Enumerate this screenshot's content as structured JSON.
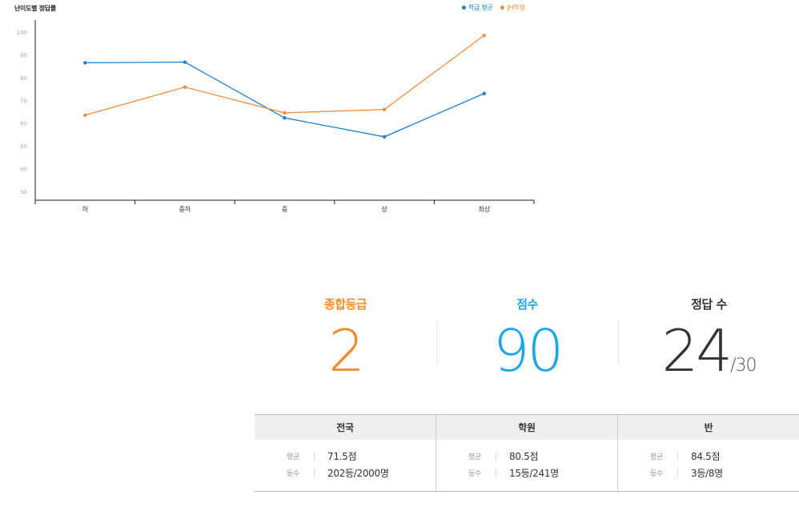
{
  "chart_data": {
    "type": "line",
    "title": "난이도별 정답률",
    "categories": [
      "하",
      "중하",
      "중",
      "상",
      "최상"
    ],
    "ylim": [
      30,
      100
    ],
    "yticks": [
      30,
      40,
      50,
      60,
      70,
      80,
      90,
      100
    ],
    "grid": false,
    "legend_position": "top-right",
    "series": [
      {
        "name": "학급 평균",
        "color": "#1a7fd6",
        "values": [
          86.5,
          86.8,
          62.3,
          54,
          73
        ]
      },
      {
        "name": "JH학생",
        "color": "#f28c3a",
        "values": [
          63.5,
          75.8,
          64.5,
          66,
          98.5
        ]
      }
    ]
  },
  "summary": {
    "grade": {
      "label": "종합등급",
      "value": "2",
      "color": "#f28c28"
    },
    "score": {
      "label": "점수",
      "value": "90",
      "color": "#1ea6ea"
    },
    "correct": {
      "label": "정답 수",
      "value": "24",
      "total": "/30",
      "color": "#333333"
    }
  },
  "comparison": {
    "columns": [
      {
        "header": "전국",
        "avg_label": "평균",
        "avg": "71.5점",
        "rank_label": "등수",
        "rank": "202등/2000명"
      },
      {
        "header": "학원",
        "avg_label": "평균",
        "avg": "80.5점",
        "rank_label": "등수",
        "rank": "15등/241명"
      },
      {
        "header": "반",
        "avg_label": "평균",
        "avg": "84.5점",
        "rank_label": "등수",
        "rank": "3등/8명"
      }
    ]
  }
}
